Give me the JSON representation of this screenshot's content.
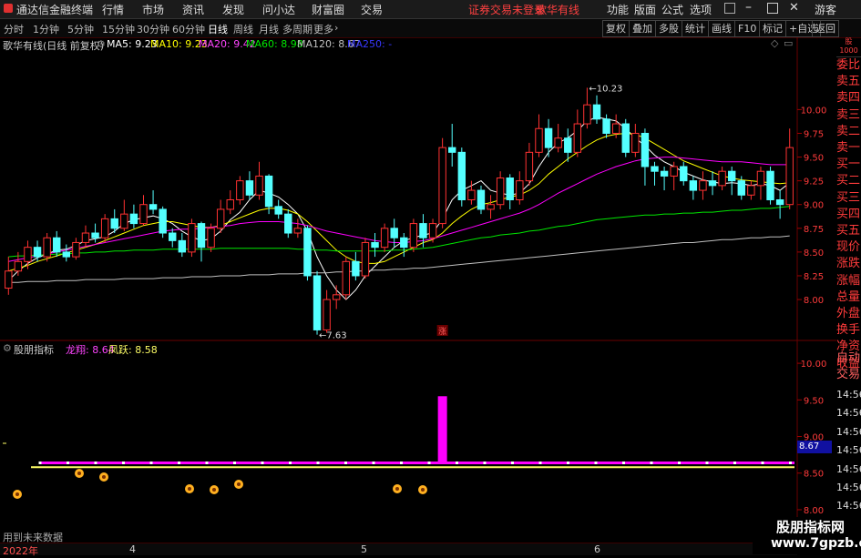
{
  "app": {
    "title": "通达信金融终端",
    "status_text": "证券交易未登录",
    "stock_name_top": "歌华有线",
    "guest": "游客"
  },
  "menu": [
    "行情",
    "市场",
    "资讯",
    "发现",
    "问小达",
    "财富圈",
    "交易"
  ],
  "right_menu": [
    "功能",
    "版面",
    "公式",
    "选项"
  ],
  "periods": [
    "分时",
    "1分钟",
    "5分钟",
    "15分钟",
    "30分钟",
    "60分钟",
    "日线",
    "周线",
    "月线",
    "多周期",
    "更多"
  ],
  "active_period": "日线",
  "tools": [
    "复权",
    "叠加",
    "多股",
    "统计",
    "画线",
    "F10",
    "标记",
    "+自选",
    "返回"
  ],
  "main_info": {
    "name": "歌华有线(日线 前复权)",
    "ma5": "MA5: 9.23",
    "ma10": "MA10: 9.23",
    "ma20": "MA20: 9.42",
    "ma60": "MA60: 8.98",
    "ma120": "MA120: 8.67",
    "ma250": "MA250: -"
  },
  "sub_info": {
    "name": "股朋指标",
    "longxiang": "龙翔: 8.64",
    "fengyue": "凤跃: 8.58"
  },
  "sub_badge": "8.67",
  "side_items": [
    "委比",
    "卖五",
    "卖四",
    "卖三",
    "卖二",
    "卖一",
    "买一",
    "买二",
    "买三",
    "买四",
    "买五",
    "现价",
    "涨跌",
    "涨幅",
    "总量",
    "外盘",
    "换手",
    "净资",
    "收益",
    "自动",
    "交易",
    "14:56",
    "14:56",
    "14:56",
    "14:56",
    "14:56",
    "14:56",
    "14:56",
    "14:56"
  ],
  "bottom": {
    "no_future": "用到未来数据",
    "year_label": "2022年",
    "months": [
      "4",
      "5",
      "6"
    ]
  },
  "mark_zhang": "涨",
  "watermark": {
    "title": "股朋指标网",
    "url": "www.7gpzb.com"
  },
  "colors": {
    "up": "#ff3232",
    "down": "#54ffff",
    "ma5": "#ffffff",
    "ma10": "#ffff00",
    "ma20": "#ff00ff",
    "ma60": "#00e600",
    "ma120": "#c0c0c0",
    "ma250": "#3030ff"
  },
  "chart_data": {
    "type": "candlestick",
    "title": "歌华有线(日线 前复权)",
    "y_ticks": [
      "10.00",
      "9.75",
      "9.50",
      "9.25",
      "9.00",
      "8.75",
      "8.50",
      "8.25",
      "8.00"
    ],
    "sub_y_ticks": [
      "10.00",
      "9.50",
      "9.00",
      "8.50",
      "8.00"
    ],
    "high_label": "10.23",
    "low_label": "7.63",
    "ylim": [
      7.55,
      10.55
    ],
    "sub_ylim": [
      7.9,
      10.2
    ],
    "candles": [
      [
        8.12,
        8.3,
        8.45,
        8.05
      ],
      [
        8.3,
        8.4,
        8.5,
        8.25
      ],
      [
        8.4,
        8.55,
        8.62,
        8.32
      ],
      [
        8.55,
        8.45,
        8.62,
        8.4
      ],
      [
        8.45,
        8.65,
        8.7,
        8.4
      ],
      [
        8.65,
        8.5,
        8.72,
        8.45
      ],
      [
        8.5,
        8.45,
        8.58,
        8.4
      ],
      [
        8.45,
        8.6,
        8.65,
        8.42
      ],
      [
        8.6,
        8.7,
        8.78,
        8.55
      ],
      [
        8.7,
        8.65,
        8.8,
        8.6
      ],
      [
        8.65,
        8.85,
        8.9,
        8.6
      ],
      [
        8.85,
        8.75,
        8.95,
        8.7
      ],
      [
        8.75,
        8.9,
        9.05,
        8.72
      ],
      [
        8.9,
        8.8,
        9.0,
        8.75
      ],
      [
        8.8,
        9.0,
        9.1,
        8.78
      ],
      [
        9.0,
        8.95,
        9.15,
        8.9
      ],
      [
        8.95,
        8.7,
        8.98,
        8.65
      ],
      [
        8.7,
        8.62,
        8.75,
        8.55
      ],
      [
        8.62,
        8.5,
        8.7,
        8.45
      ],
      [
        8.5,
        8.8,
        8.85,
        8.45
      ],
      [
        8.8,
        8.55,
        8.82,
        8.4
      ],
      [
        8.55,
        8.75,
        8.8,
        8.5
      ],
      [
        8.75,
        8.95,
        9.05,
        8.7
      ],
      [
        8.95,
        9.05,
        9.15,
        8.9
      ],
      [
        9.05,
        9.25,
        9.3,
        9.0
      ],
      [
        9.25,
        9.1,
        9.35,
        9.05
      ],
      [
        9.1,
        9.3,
        9.45,
        9.05
      ],
      [
        9.3,
        8.98,
        9.32,
        8.9
      ],
      [
        8.98,
        8.9,
        9.05,
        8.85
      ],
      [
        8.9,
        8.7,
        8.95,
        8.65
      ],
      [
        8.7,
        8.75,
        8.85,
        8.65
      ],
      [
        8.75,
        8.25,
        8.78,
        8.2
      ],
      [
        8.25,
        7.68,
        8.3,
        7.63
      ],
      [
        7.68,
        8.0,
        8.1,
        7.65
      ],
      [
        8.0,
        8.05,
        8.15,
        7.9
      ],
      [
        8.05,
        8.4,
        8.45,
        8.0
      ],
      [
        8.4,
        8.25,
        8.5,
        8.2
      ],
      [
        8.25,
        8.6,
        8.65,
        8.22
      ],
      [
        8.6,
        8.55,
        8.7,
        8.45
      ],
      [
        8.55,
        8.75,
        8.8,
        8.5
      ],
      [
        8.75,
        8.65,
        8.85,
        8.55
      ],
      [
        8.65,
        8.55,
        8.7,
        8.45
      ],
      [
        8.55,
        8.8,
        8.85,
        8.5
      ],
      [
        8.8,
        8.65,
        8.9,
        8.55
      ],
      [
        8.65,
        8.8,
        8.85,
        8.6
      ],
      [
        8.8,
        9.6,
        9.7,
        8.75
      ],
      [
        9.6,
        9.55,
        9.85,
        9.4
      ],
      [
        9.55,
        9.05,
        9.6,
        8.98
      ],
      [
        9.05,
        9.15,
        9.25,
        9.0
      ],
      [
        9.15,
        8.95,
        9.2,
        8.9
      ],
      [
        8.95,
        9.0,
        9.1,
        8.85
      ],
      [
        9.0,
        9.28,
        9.35,
        8.95
      ],
      [
        9.28,
        9.05,
        9.32,
        8.95
      ],
      [
        9.05,
        9.25,
        9.35,
        9.0
      ],
      [
        9.25,
        9.55,
        9.65,
        9.2
      ],
      [
        9.55,
        9.8,
        9.95,
        9.5
      ],
      [
        9.8,
        9.6,
        9.9,
        9.5
      ],
      [
        9.6,
        9.7,
        9.85,
        9.55
      ],
      [
        9.7,
        9.55,
        9.8,
        9.45
      ],
      [
        9.55,
        9.85,
        10.0,
        9.5
      ],
      [
        9.85,
        10.05,
        10.23,
        9.8
      ],
      [
        10.05,
        9.9,
        10.15,
        9.85
      ],
      [
        9.9,
        9.75,
        9.95,
        9.7
      ],
      [
        9.75,
        9.85,
        9.95,
        9.7
      ],
      [
        9.85,
        9.55,
        9.9,
        9.5
      ],
      [
        9.55,
        9.75,
        9.85,
        9.5
      ],
      [
        9.75,
        9.4,
        9.8,
        9.2
      ],
      [
        9.4,
        9.35,
        9.45,
        9.2
      ],
      [
        9.35,
        9.3,
        9.4,
        9.15
      ],
      [
        9.3,
        9.4,
        9.45,
        9.15
      ],
      [
        9.4,
        9.25,
        9.45,
        9.2
      ],
      [
        9.25,
        9.15,
        9.3,
        9.05
      ],
      [
        9.15,
        9.25,
        9.35,
        9.05
      ],
      [
        9.25,
        9.2,
        9.35,
        9.1
      ],
      [
        9.2,
        9.35,
        9.4,
        9.15
      ],
      [
        9.35,
        9.25,
        9.4,
        9.1
      ],
      [
        9.25,
        9.1,
        9.3,
        9.05
      ],
      [
        9.1,
        9.2,
        9.25,
        9.05
      ],
      [
        9.2,
        9.35,
        9.4,
        9.05
      ],
      [
        9.35,
        9.05,
        9.4,
        9.0
      ],
      [
        9.05,
        9.0,
        9.15,
        8.85
      ],
      [
        9.0,
        9.6,
        9.8,
        8.95
      ]
    ],
    "ma_series": [
      {
        "name": "MA5",
        "values": [
          8.2,
          8.3,
          8.38,
          8.44,
          8.48,
          8.52,
          8.53,
          8.57,
          8.62,
          8.64,
          8.66,
          8.72,
          8.8,
          8.84,
          8.86,
          8.88,
          8.85,
          8.8,
          8.72,
          8.66,
          8.62,
          8.64,
          8.72,
          8.84,
          8.92,
          9.05,
          9.15,
          9.12,
          9.08,
          9.0,
          8.9,
          8.72,
          8.45,
          8.25,
          8.1,
          8.0,
          8.1,
          8.25,
          8.35,
          8.45,
          8.55,
          8.62,
          8.65,
          8.68,
          8.7,
          8.85,
          9.05,
          9.15,
          9.2,
          9.25,
          9.15,
          9.12,
          9.1,
          9.12,
          9.22,
          9.4,
          9.55,
          9.65,
          9.7,
          9.78,
          9.88,
          9.92,
          9.9,
          9.88,
          9.8,
          9.7,
          9.62,
          9.52,
          9.45,
          9.4,
          9.34,
          9.3,
          9.26,
          9.24,
          9.22,
          9.23,
          9.22,
          9.2,
          9.22,
          9.2,
          9.15,
          9.23
        ]
      },
      {
        "name": "MA10",
        "values": [
          8.3,
          8.33,
          8.36,
          8.4,
          8.43,
          8.46,
          8.49,
          8.52,
          8.55,
          8.58,
          8.62,
          8.66,
          8.7,
          8.74,
          8.78,
          8.8,
          8.82,
          8.82,
          8.8,
          8.78,
          8.76,
          8.76,
          8.78,
          8.82,
          8.86,
          8.9,
          8.94,
          8.96,
          8.96,
          8.94,
          8.9,
          8.82,
          8.72,
          8.62,
          8.52,
          8.45,
          8.4,
          8.38,
          8.38,
          8.4,
          8.45,
          8.5,
          8.55,
          8.6,
          8.63,
          8.7,
          8.8,
          8.88,
          8.95,
          9.0,
          9.02,
          9.05,
          9.08,
          9.1,
          9.15,
          9.22,
          9.32,
          9.4,
          9.48,
          9.55,
          9.62,
          9.68,
          9.72,
          9.74,
          9.75,
          9.74,
          9.7,
          9.64,
          9.58,
          9.52,
          9.46,
          9.42,
          9.38,
          9.34,
          9.3,
          9.28,
          9.26,
          9.25,
          9.24,
          9.23,
          9.22,
          9.23
        ]
      },
      {
        "name": "MA20",
        "values": [
          8.4,
          8.42,
          8.44,
          8.46,
          8.48,
          8.5,
          8.52,
          8.54,
          8.56,
          8.58,
          8.6,
          8.62,
          8.64,
          8.66,
          8.68,
          8.7,
          8.72,
          8.73,
          8.74,
          8.74,
          8.75,
          8.76,
          8.77,
          8.78,
          8.8,
          8.81,
          8.82,
          8.82,
          8.82,
          8.81,
          8.8,
          8.78,
          8.75,
          8.72,
          8.7,
          8.68,
          8.66,
          8.64,
          8.62,
          8.61,
          8.6,
          8.6,
          8.61,
          8.62,
          8.64,
          8.67,
          8.7,
          8.73,
          8.76,
          8.79,
          8.82,
          8.85,
          8.88,
          8.91,
          8.95,
          9.0,
          9.06,
          9.12,
          9.17,
          9.22,
          9.27,
          9.32,
          9.36,
          9.4,
          9.43,
          9.46,
          9.48,
          9.49,
          9.5,
          9.5,
          9.49,
          9.48,
          9.47,
          9.46,
          9.45,
          9.45,
          9.45,
          9.44,
          9.43,
          9.42,
          9.42,
          9.42
        ]
      },
      {
        "name": "MA60",
        "values": [
          8.45,
          8.46,
          8.46,
          8.47,
          8.47,
          8.48,
          8.48,
          8.49,
          8.49,
          8.5,
          8.5,
          8.51,
          8.51,
          8.52,
          8.52,
          8.52,
          8.53,
          8.53,
          8.53,
          8.53,
          8.53,
          8.53,
          8.54,
          8.54,
          8.54,
          8.54,
          8.54,
          8.54,
          8.54,
          8.54,
          8.53,
          8.53,
          8.52,
          8.52,
          8.51,
          8.51,
          8.51,
          8.51,
          8.51,
          8.51,
          8.52,
          8.52,
          8.53,
          8.54,
          8.55,
          8.57,
          8.59,
          8.61,
          8.63,
          8.65,
          8.66,
          8.68,
          8.69,
          8.7,
          8.72,
          8.73,
          8.75,
          8.77,
          8.78,
          8.8,
          8.82,
          8.84,
          8.85,
          8.86,
          8.87,
          8.88,
          8.89,
          8.89,
          8.9,
          8.9,
          8.91,
          8.91,
          8.92,
          8.92,
          8.93,
          8.94,
          8.94,
          8.95,
          8.96,
          8.96,
          8.97,
          8.98
        ]
      },
      {
        "name": "MA120",
        "values": [
          8.18,
          8.18,
          8.19,
          8.19,
          8.19,
          8.2,
          8.2,
          8.2,
          8.21,
          8.21,
          8.21,
          8.21,
          8.22,
          8.22,
          8.22,
          8.22,
          8.23,
          8.23,
          8.23,
          8.24,
          8.24,
          8.24,
          8.25,
          8.25,
          8.25,
          8.26,
          8.26,
          8.26,
          8.27,
          8.27,
          8.27,
          8.28,
          8.28,
          8.28,
          8.29,
          8.29,
          8.3,
          8.3,
          8.31,
          8.31,
          8.32,
          8.32,
          8.33,
          8.33,
          8.34,
          8.35,
          8.36,
          8.37,
          8.38,
          8.39,
          8.4,
          8.41,
          8.42,
          8.43,
          8.44,
          8.45,
          8.46,
          8.47,
          8.48,
          8.49,
          8.5,
          8.51,
          8.52,
          8.53,
          8.54,
          8.55,
          8.56,
          8.57,
          8.58,
          8.59,
          8.6,
          8.6,
          8.61,
          8.62,
          8.63,
          8.63,
          8.64,
          8.65,
          8.65,
          8.66,
          8.66,
          8.67
        ]
      }
    ],
    "sub_series": [
      {
        "name": "龙翔",
        "value": 8.64
      },
      {
        "name": "凤跃",
        "value": 8.58
      }
    ],
    "sub_spike": {
      "index": 45,
      "from": 8.64,
      "to": 9.55
    }
  }
}
